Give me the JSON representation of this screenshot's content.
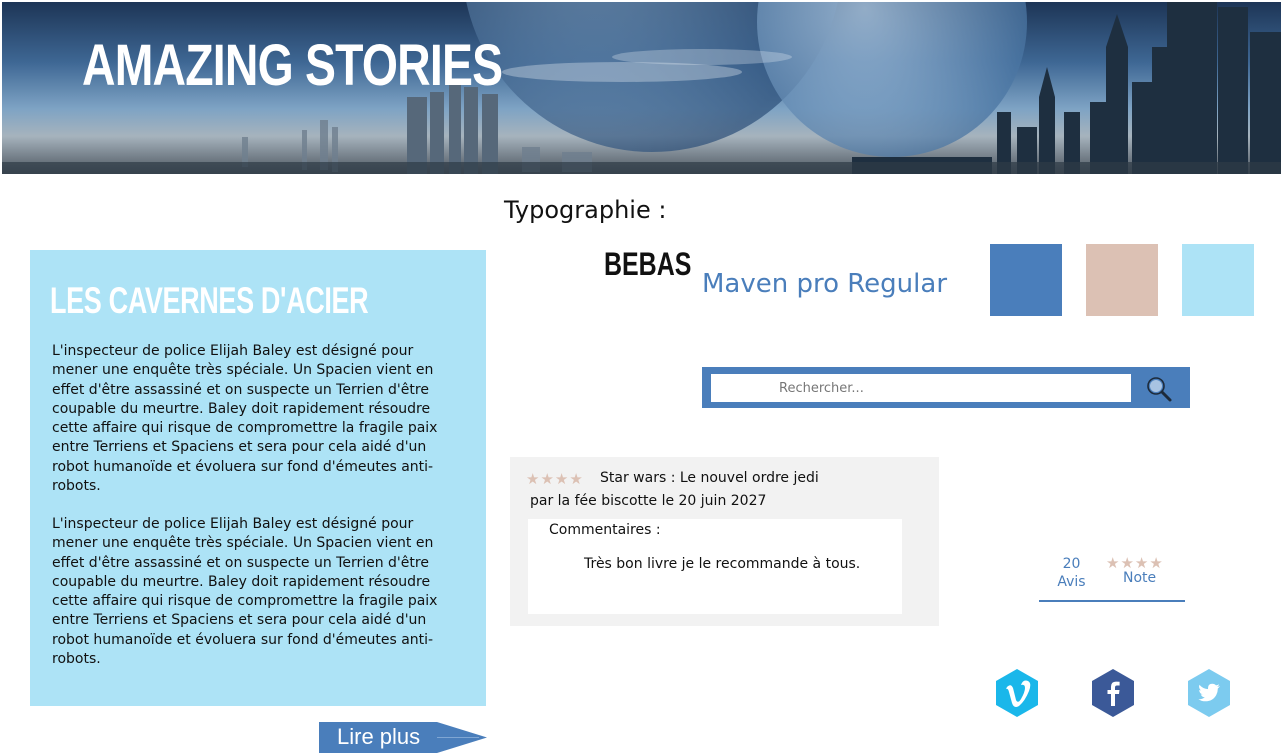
{
  "banner": {
    "title": "AMAZING STORIES"
  },
  "article": {
    "title": "LES CAVERNES D'ACIER",
    "paragraphs": [
      "L'inspecteur de police Elijah Baley est désigné pour mener une enquête très spéciale. Un Spacien vient en effet d'être assassiné et on suspecte un Terrien d'être coupable du meurtre. Baley doit rapidement résoudre cette affaire qui risque de compromettre la fragile paix entre Terriens et Spaciens et sera pour cela aidé d'un robot humanoïde et évoluera sur fond d'émeutes anti-robots.",
      "L'inspecteur de police Elijah Baley est désigné pour mener une enquête très spéciale. Un Spacien vient en effet d'être assassiné et on suspecte un Terrien d'être coupable du meurtre. Baley doit rapidement résoudre cette affaire qui risque de compromettre la fragile paix entre Terriens et Spaciens et sera pour cela aidé d'un robot humanoïde et évoluera sur fond d'émeutes anti-robots."
    ],
    "read_more": "Lire plus"
  },
  "typography": {
    "label": "Typographie :",
    "font1": "BEBAS",
    "font2": "Maven pro Regular"
  },
  "palette": [
    "#4a7ebb",
    "#dcc1b4",
    "#ade3f6"
  ],
  "search": {
    "placeholder": "Rechercher...",
    "icon": "magnifier-icon"
  },
  "review": {
    "stars": "★★★★",
    "title": "Star wars : Le nouvel ordre jedi",
    "meta": "par la fée biscotte le 20 juin 2027",
    "comment_label": "Commentaires :",
    "comment": "Très bon livre je le recommande à tous."
  },
  "rating": {
    "count": "20",
    "count_label": "Avis",
    "stars": "★★★★",
    "note_label": "Note"
  },
  "social": [
    {
      "name": "vimeo",
      "icon": "vimeo-icon",
      "color": "#1ab7ea"
    },
    {
      "name": "facebook",
      "icon": "facebook-icon",
      "color": "#3b5998"
    },
    {
      "name": "twitter",
      "icon": "twitter-icon",
      "color": "#7ccbef"
    }
  ]
}
